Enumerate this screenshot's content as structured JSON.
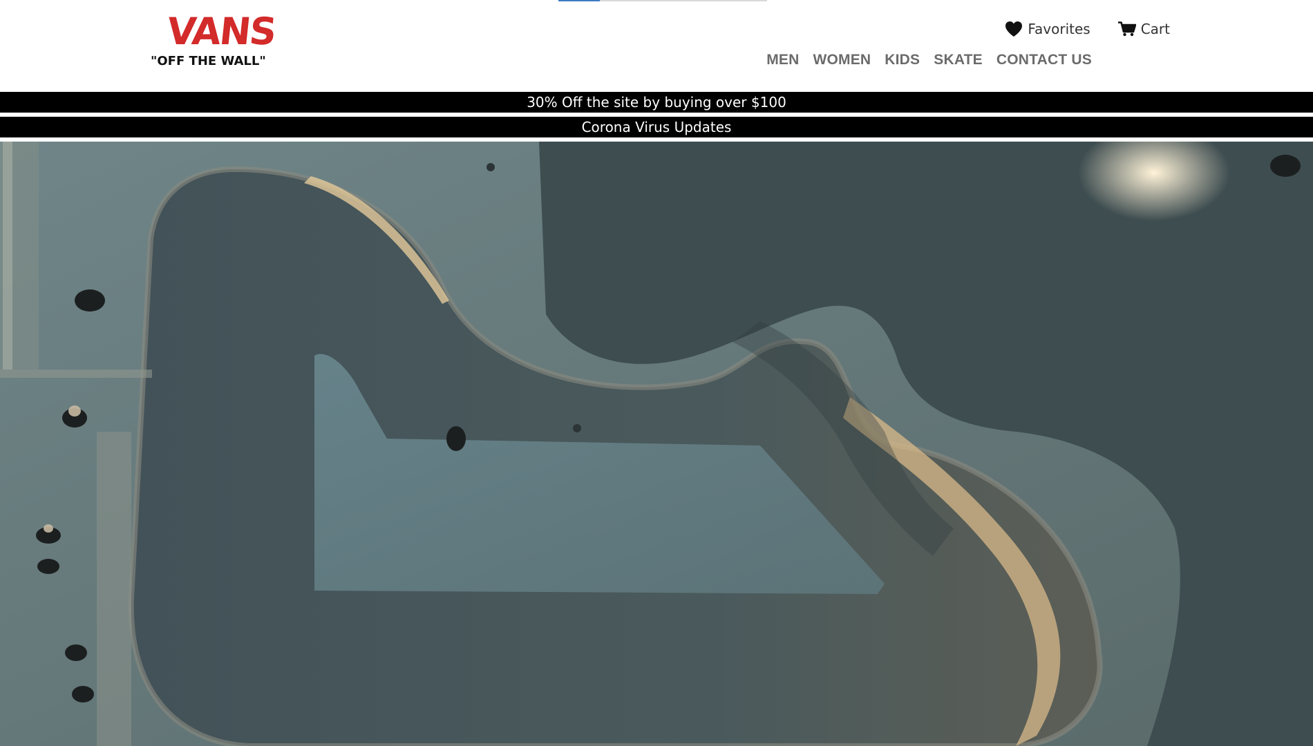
{
  "brand": {
    "logo_text": "VANS",
    "tagline": "\"OFF THE WALL\"",
    "logo_color": "#d32a2a"
  },
  "header": {
    "favorites_label": "Favorites",
    "favorites_icon": "heart-icon",
    "cart_label": "Cart",
    "cart_icon": "cart-icon"
  },
  "nav": {
    "items": [
      {
        "label": "MEN"
      },
      {
        "label": "WOMEN"
      },
      {
        "label": "KIDS"
      },
      {
        "label": "SKATE"
      },
      {
        "label": "CONTACT US"
      }
    ]
  },
  "announcements": [
    {
      "text": "30% Off the site by buying over $100"
    },
    {
      "text": "Corona Virus Updates"
    }
  ],
  "colors": {
    "bar_background": "#000000",
    "bar_text": "#ffffff",
    "nav_text": "#6b6b6b"
  }
}
